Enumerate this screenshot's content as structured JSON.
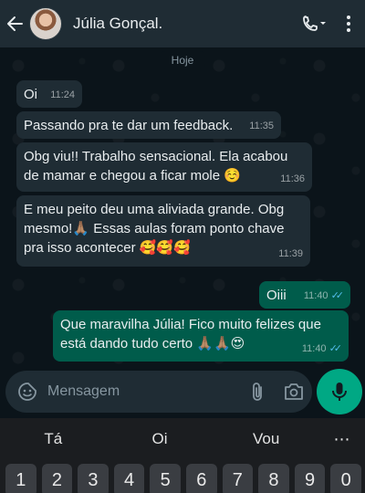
{
  "header": {
    "contact_name": "Júlia Gonçal.",
    "icons": [
      "back-arrow-icon",
      "avatar",
      "call-icon",
      "more-vert-icon"
    ]
  },
  "chat": {
    "date_chip": "Hoje",
    "messages": [
      {
        "direction": "in",
        "text": "Oi",
        "time": "11:24"
      },
      {
        "direction": "in",
        "text": "Passando pra te dar um feedback.",
        "time": "11:35"
      },
      {
        "direction": "in",
        "line1": "Obg viu!! Trabalho sensacional. Ela acabou",
        "line2": "de mamar e chegou a ficar mole",
        "emoji": "☺️",
        "time": "11:36"
      },
      {
        "direction": "in",
        "line1": "E meu peito deu uma aliviada grande. Obg",
        "line2": "mesmo!",
        "emoji_a": "🙏🏽",
        "line2b": " Essas aulas foram ponto chave",
        "line3": "pra isso acontecer",
        "emoji_b": "🥰🥰🥰",
        "time": "11:39"
      },
      {
        "direction": "out",
        "text": "Oiii",
        "time": "11:40",
        "ticks": "✓✓"
      },
      {
        "direction": "out",
        "line1": "Que maravilha Júlia! Fico muito felizes que",
        "line2": "está dando tudo certo",
        "emoji": "🙏🏽🙏🏽😍",
        "time": "11:40",
        "ticks": "✓✓"
      }
    ]
  },
  "composer": {
    "placeholder": "Mensagem",
    "icons": [
      "sticker-icon",
      "attach-icon",
      "camera-icon",
      "mic-icon"
    ]
  },
  "keyboard": {
    "suggestions": [
      "Tá",
      "Oi",
      "Vou"
    ],
    "more": "⋯",
    "number_keys": [
      "1",
      "2",
      "3",
      "4",
      "5",
      "6",
      "7",
      "8",
      "9",
      "0"
    ]
  },
  "colors": {
    "header_bg": "#1f2c34",
    "chat_bg": "#0b141a",
    "incoming_bubble": "#1f2c34",
    "outgoing_bubble": "#005c4b",
    "accent": "#00a884",
    "read_ticks": "#53bdeb"
  }
}
